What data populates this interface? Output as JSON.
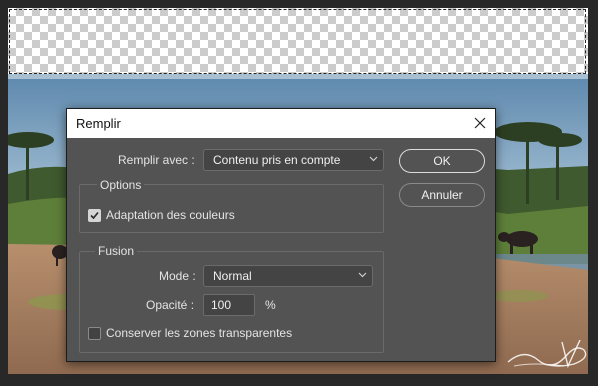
{
  "dialog": {
    "title": "Remplir",
    "fill_label": "Remplir avec :",
    "fill_value": "Contenu pris en compte",
    "ok_label": "OK",
    "cancel_label": "Annuler"
  },
  "options": {
    "title": "Options",
    "color_adaptation_label": "Adaptation des couleurs",
    "color_adaptation_checked": true
  },
  "fusion": {
    "title": "Fusion",
    "mode_label": "Mode :",
    "mode_value": "Normal",
    "opacity_label": "Opacité :",
    "opacity_value": "100",
    "opacity_unit": "%",
    "preserve_label": "Conserver les zones transparentes",
    "preserve_checked": false
  },
  "watermark": {
    "signature": "François Vallet"
  },
  "colors": {
    "dialog_bg": "#535353",
    "app_bg": "#282828",
    "titlebar_bg": "#ffffff"
  },
  "icons": {
    "close": "close-icon",
    "dropdown": "chevron-down-icon",
    "check": "checkmark-icon"
  }
}
